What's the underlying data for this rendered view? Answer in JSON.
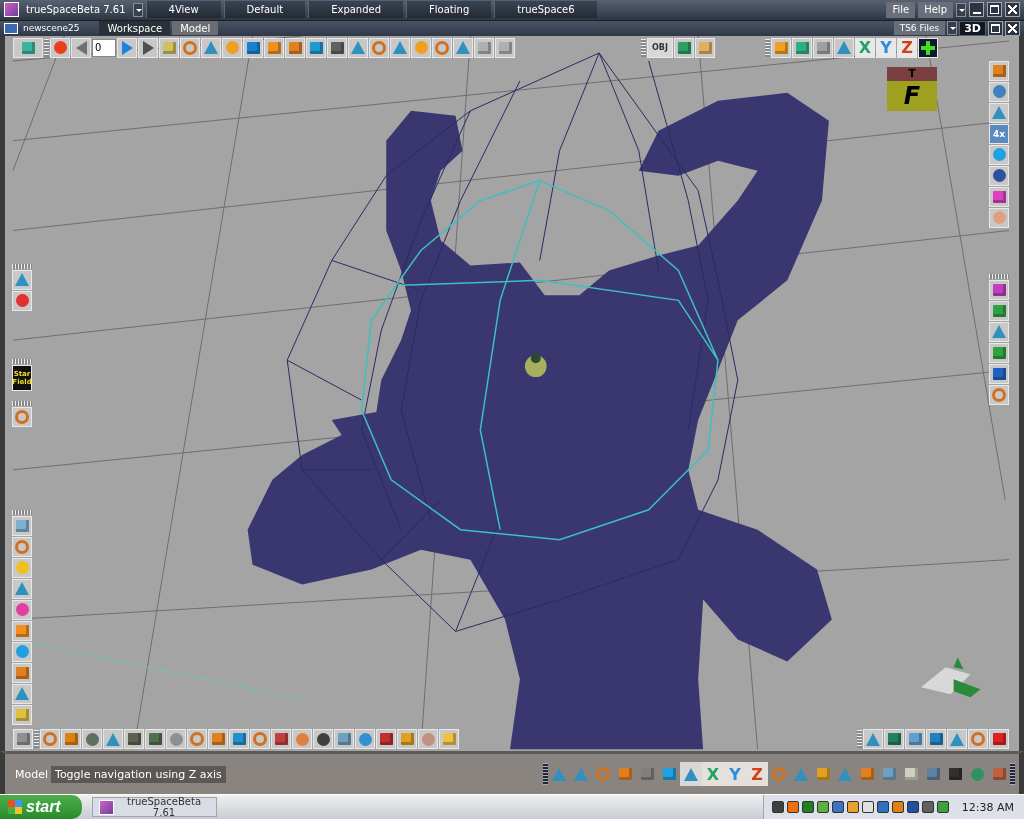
{
  "window": {
    "title": "trueSpaceBeta 7.61"
  },
  "layouts": [
    "4View",
    "Default",
    "Expanded",
    "Floating",
    "trueSpace6"
  ],
  "menu": [
    "File",
    "Help"
  ],
  "scene": {
    "title": "newscene25"
  },
  "tabs": [
    {
      "label": "Workspace",
      "selected": true
    },
    {
      "label": "Model",
      "selected": false
    }
  ],
  "files_button": "TS6 Files",
  "view_mode": "3D",
  "frame_field": {
    "value": "0"
  },
  "object_button": "OBJ",
  "axis_buttons_top": [
    {
      "label": "X",
      "color": "#1fa463"
    },
    {
      "label": "Y",
      "color": "#2e8fd6"
    },
    {
      "label": "Z",
      "color": "#d2401a"
    }
  ],
  "nav_cube": {
    "top": "T",
    "front": "F"
  },
  "left_panel": {
    "star_field": "Star Field"
  },
  "right_panel": {
    "multi_view": "4x"
  },
  "status": {
    "mode": "Model",
    "message": "Toggle navigation using Z axis"
  },
  "axis_buttons_bottom": [
    {
      "label": "X",
      "color": "#1fa463"
    },
    {
      "label": "Y",
      "color": "#2e8fd6"
    },
    {
      "label": "Z",
      "color": "#d2401a"
    }
  ],
  "taskbar": {
    "start": "start",
    "task": "trueSpaceBeta 7.61",
    "clock": "12:38 AM"
  }
}
